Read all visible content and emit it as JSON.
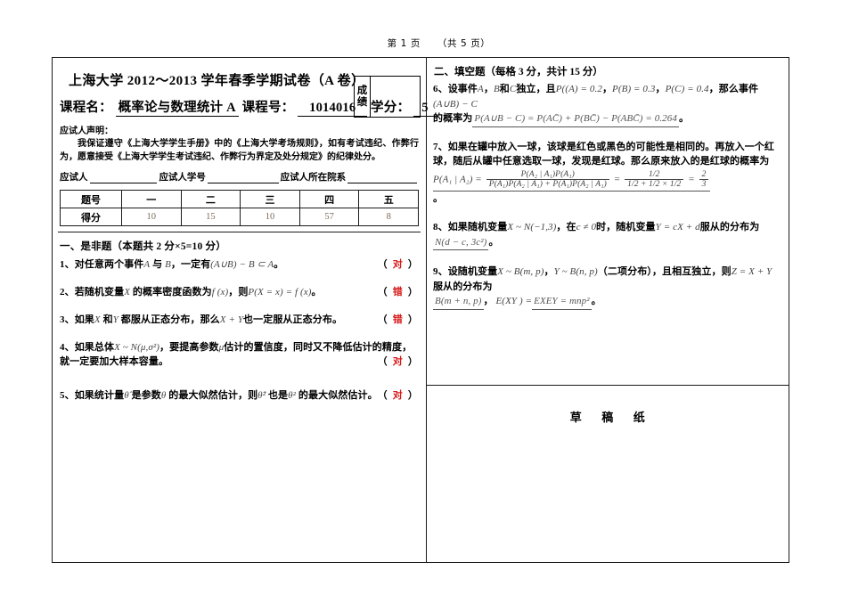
{
  "header": {
    "page_current": "第 1 页",
    "page_total": "（共 5 页）"
  },
  "exam": {
    "university_title_prefix": "上海大学",
    "years": "2012～2013",
    "title_suffix": "学年春季学期试卷（A 卷）",
    "course_label": "课程名：",
    "course_name": "概率论与数理统计 A",
    "course_no_label": "课程号：",
    "course_no": "1014016",
    "credit_label": "学分：",
    "credit": "5",
    "score_box_label_1": "成",
    "score_box_label_2": "绩"
  },
  "declaration": {
    "title": "应试人声明：",
    "body": "我保证遵守《上海大学学生手册》中的《上海大学考场规则》，如有考试违纪、作弊行为，愿意接受《上海大学学生考试违纪、作弊行为界定及处分规定》的纪律处分。",
    "field_name": "应试人",
    "field_id": "应试人学号",
    "field_dept": "应试人所在院系"
  },
  "score_table": {
    "row_label_q": "题号",
    "row_label_score": "得分",
    "question_numbers": [
      "一",
      "二",
      "三",
      "四",
      "五"
    ],
    "scores": [
      "10",
      "15",
      "10",
      "57",
      "8"
    ]
  },
  "section_tf": {
    "title": "一、是非题（本题共 2 分×5=10 分）",
    "items": [
      {
        "no": "1、",
        "text": "对任意两个事件",
        "var1": "A",
        "mid": "与",
        "var2": "B",
        "text2": "，一定有",
        "formula": "(A∪B) − B ⊂ A",
        "tail": "。",
        "answer": "对"
      },
      {
        "no": "2、",
        "text": "若随机变量",
        "var1": "X",
        "text2": "的概率密度函数为",
        "formula": "f (x)",
        "text3": "，则",
        "formula2": "P(X = x) = f (x)",
        "tail": "。",
        "answer": "错"
      },
      {
        "no": "3、",
        "text": "如果",
        "var1": "X",
        "mid": "和",
        "var2": "Y",
        "text2": "都服从正态分布，那么",
        "formula": "X + Y",
        "text3": "也一定服从正态分布。",
        "answer": "错"
      },
      {
        "no": "4、",
        "text": "如果总体",
        "formula": "X ~ N(μ,σ²)",
        "text2": "，要提高参数",
        "var1": "μ",
        "text3": "估计的置信度，同时又不降低估计的精度，",
        "line2": "就一定要加大样本容量。",
        "answer": "对"
      },
      {
        "no": "5、",
        "text": "如果统计量",
        "formula": "θ̂",
        "text2": "是参数",
        "var1": "θ",
        "text3": "的最大似然估计，则",
        "formula2": "θ̂²",
        "text4": "也是",
        "var2": "θ²",
        "text5": "的最大似然估计。",
        "answer": "对"
      }
    ],
    "answer_open": "（",
    "answer_close": "）"
  },
  "section_blank": {
    "title": "二、填空题（每格 3 分，共计 15 分）",
    "q6": {
      "no": "6、",
      "t1": "设事件",
      "v1": "A",
      "t2": "，",
      "v2": "B",
      "t3": "和",
      "v3": "C",
      "t4": "独立，且",
      "f1": "P((A) = 0.2",
      "t5": "，",
      "f2": "P(B) = 0.3",
      "t6": "，",
      "f3": "P(C) = 0.4",
      "t7": "，那么事件",
      "f4": "(A∪B) − C",
      "t8": "的概率为",
      "answer": "P(A∪B − C) = P(AC̄) + P(BC̄) − P(ABC̄) = 0.264",
      "tail": "。"
    },
    "q7": {
      "no": "7、",
      "text": "如果在罐中放入一球，该球是红色或黑色的可能性是相同的。再放入一个红球，随后从罐中任意选取一球，发现是红球。那么原来放入的是红球的概率为",
      "lhs": "P(A₁ | A₂) =",
      "frac1_num": "P(A₂ | A₁)P(A₁)",
      "frac1_den": "P(A₁)P(A₂ | A₁) + P(Ā₁)P(A₂ | Ā₁)",
      "eq1": "=",
      "frac2_num": "1/2",
      "frac2_den": "1/2 + 1/2 × 1/2",
      "eq2": "=",
      "frac3_num": "2",
      "frac3_den": "3",
      "tail": "。"
    },
    "q8": {
      "no": "8、",
      "t1": "如果随机变量",
      "f1": "X ~ N(−1,3)",
      "t2": "，在",
      "f2": "c ≠ 0",
      "t3": "时，随机变量",
      "f3": "Y = cX + d",
      "t4": "服从的分布为",
      "answer": "N(d − c, 3c²)",
      "tail": "。"
    },
    "q9": {
      "no": "9、",
      "t1": "设随机变量",
      "f1": "X ~ B(m, p)",
      "t2": "，",
      "f2": "Y ~ B(n, p)",
      "t3": "（二项分布），且相互独立，则",
      "f3": "Z = X + Y",
      "t4": "服从的分布为",
      "answer1": "B(m + n, p)",
      "t5": "，",
      "f4": "E(XY ) =",
      "answer2": "EXEY = mnp²",
      "tail": "。"
    }
  },
  "draft": {
    "label_1": "草",
    "label_2": "稿",
    "label_3": "纸"
  },
  "colors": {
    "answer_mark": "#d81a1a",
    "score_number": "#7a6a5a",
    "border": "#1a1a1a",
    "math": "#444444"
  }
}
